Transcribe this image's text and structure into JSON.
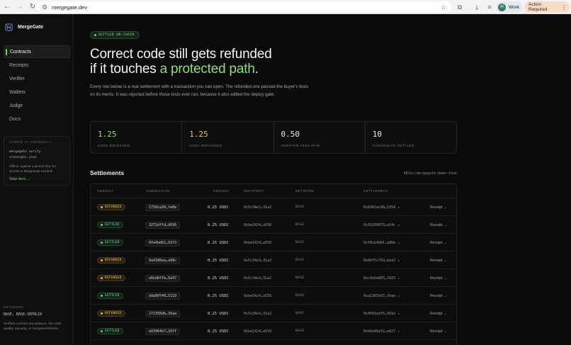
{
  "browser": {
    "url": "mergegate.dev",
    "profile_initial": "H",
    "profile_label": "Work",
    "action_label": "Action Required"
  },
  "sidebar": {
    "brand": "MergeGate",
    "items": [
      {
        "label": "Contracts",
        "active": true
      },
      {
        "label": "Receipts",
        "active": false
      },
      {
        "label": "Verifier",
        "active": false
      },
      {
        "label": "Wallets",
        "active": false
      },
      {
        "label": "Judge",
        "active": false
      },
      {
        "label": "Docs",
        "active": false
      }
    ],
    "check": {
      "title": "CHECK IT YOURSELF",
      "cmd_line1": "mergegate verify",
      "cmd_line2": "<receipt>.json",
      "desc": "Offline, against a pinned key. No access to MergeGate needed.",
      "link": "View docs →"
    },
    "network": {
      "label": "NETWORK",
      "value": "BASE, BASE-SEPOLIA",
      "desc": "Verified contract acceptance, not code quality, security, or mergeworthiness."
    }
  },
  "main": {
    "badge": "SETTLED ON-CHAIN",
    "hero_line1": "Correct code still gets refunded",
    "hero_line2_pre": "if it touches ",
    "hero_line2_accent": "a protected path",
    "hero_line2_post": ".",
    "lede": "Every row below is a real settlement with a transaction you can open. The refunded one passed the buyer's tests on its merits. It was rejected before those tests ever ran, because it also edited the deploy gate.",
    "stats": [
      {
        "value": "1.25",
        "label": "USDC RELEASED",
        "tone": "green"
      },
      {
        "value": "1.25",
        "label": "USDC REFUNDED",
        "tone": "amber"
      },
      {
        "value": "0.50",
        "label": "VERIFIER FEES PAID",
        "tone": "plain"
      },
      {
        "value": "10",
        "label": "CONTRACTS SETTLED",
        "tone": "plain"
      }
    ],
    "settlements_title": "Settlements",
    "repo": "48lnc/mergegate-demo-task"
  },
  "table": {
    "headers": {
      "verdict": "VERDICT",
      "submission": "SUBMISSION",
      "amount": "AMOUNT",
      "recipient": "RECIPIENT",
      "network": "NETWORK",
      "settlement": "SETTLEMENT"
    },
    "rows": [
      {
        "verdict": "REFUNDED",
        "kind": "refunded",
        "submission": "1758ca30…fe0e",
        "amount": "0.25 USDC",
        "recipient": "0x5c34e3…31a2",
        "network": "BASE",
        "settlement": "0x8362ac98…5354 ↗",
        "receipt": "Receipt →"
      },
      {
        "verdict": "SETTLED",
        "kind": "settled",
        "submission": "3272dffd…d036",
        "amount": "0.25 USDC",
        "recipient": "0xbe1424…a558",
        "network": "BASE",
        "settlement": "0x35209073…e24c ↗",
        "receipt": "Receipt →"
      },
      {
        "verdict": "SETTLED",
        "kind": "settled",
        "submission": "97e4bd61…9373",
        "amount": "0.25 USDC",
        "recipient": "0xbe1424…a558",
        "network": "BASE",
        "settlement": "0xf8cb4b0f…a9bb ↗",
        "receipt": "Receipt →"
      },
      {
        "verdict": "REFUNDED",
        "kind": "refunded",
        "submission": "9a4388aa…a98c",
        "amount": "0.25 USDC",
        "recipient": "0x5c34e3…31a2",
        "network": "BASE",
        "settlement": "0x66f5c75d…bed2 ↗",
        "receipt": "Receipt →"
      },
      {
        "verdict": "REFUNDED",
        "kind": "refunded",
        "submission": "e6bd8ffb…5e97",
        "amount": "0.25 USDC",
        "recipient": "0x5c34e3…31a2",
        "network": "BASE",
        "settlement": "0xc9a5e865…7d25 ↗",
        "receipt": "Receipt →"
      },
      {
        "verdict": "SETTLED",
        "kind": "settled",
        "submission": "e8a00740…5119",
        "amount": "0.25 USDC",
        "recipient": "0xbe1424…a558",
        "network": "BASE",
        "settlement": "0xa1303e97…fbae ↗",
        "receipt": "Receipt →"
      },
      {
        "verdict": "REFUNDED",
        "kind": "refunded",
        "submission": "272356db…30aa",
        "amount": "0.25 USDC",
        "recipient": "0x5c34e3…31a2",
        "network": "BASE",
        "settlement": "0x4581edf6…561e ↗",
        "receipt": "Receipt →"
      },
      {
        "verdict": "SETTLED",
        "kind": "settled",
        "submission": "e83964b7…10ff",
        "amount": "0.25 USDC",
        "recipient": "0xbe1424…a558",
        "network": "BASE",
        "settlement": "0xb8a45ef2…e827 ↗",
        "receipt": "Receipt →"
      }
    ]
  },
  "colors": {
    "accent_green": "#8fdc7a",
    "amber": "#e6c36a",
    "background": "#0b0b0b"
  }
}
